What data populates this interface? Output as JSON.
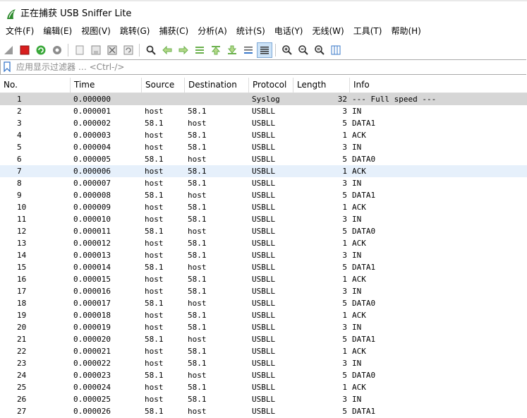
{
  "window": {
    "title": "正在捕获 USB Sniffer Lite"
  },
  "menu": [
    "文件(F)",
    "编辑(E)",
    "视图(V)",
    "跳转(G)",
    "捕获(C)",
    "分析(A)",
    "统计(S)",
    "电话(Y)",
    "无线(W)",
    "工具(T)",
    "帮助(H)"
  ],
  "toolbar_icons": [
    "shark-fin-start-icon",
    "stop-icon",
    "restart-icon",
    "gear-options-icon",
    "open-file-icon",
    "save-file-icon",
    "close-file-icon",
    "reload-icon",
    "find-icon",
    "back-arrow-icon",
    "forward-arrow-icon",
    "go-to-packet-icon",
    "first-packet-icon",
    "last-packet-icon",
    "autoscroll-icon",
    "colorize-icon",
    "zoom-in-icon",
    "zoom-out-icon",
    "normal-size-icon",
    "resize-columns-icon"
  ],
  "filter": {
    "placeholder": "应用显示过滤器 … <Ctrl-/>"
  },
  "columns": [
    "No.",
    "Time",
    "Source",
    "Destination",
    "Protocol",
    "Length",
    "Info"
  ],
  "rows": [
    {
      "no": "1",
      "time": "0.000000",
      "src": "",
      "dst": "",
      "proto": "Syslog",
      "len": "32",
      "info": "--- Full speed ---"
    },
    {
      "no": "2",
      "time": "0.000001",
      "src": "host",
      "dst": "58.1",
      "proto": "USBLL",
      "len": "3",
      "info": "IN"
    },
    {
      "no": "3",
      "time": "0.000002",
      "src": "58.1",
      "dst": "host",
      "proto": "USBLL",
      "len": "5",
      "info": "DATA1"
    },
    {
      "no": "4",
      "time": "0.000003",
      "src": "host",
      "dst": "58.1",
      "proto": "USBLL",
      "len": "1",
      "info": "ACK"
    },
    {
      "no": "5",
      "time": "0.000004",
      "src": "host",
      "dst": "58.1",
      "proto": "USBLL",
      "len": "3",
      "info": "IN"
    },
    {
      "no": "6",
      "time": "0.000005",
      "src": "58.1",
      "dst": "host",
      "proto": "USBLL",
      "len": "5",
      "info": "DATA0"
    },
    {
      "no": "7",
      "time": "0.000006",
      "src": "host",
      "dst": "58.1",
      "proto": "USBLL",
      "len": "1",
      "info": "ACK"
    },
    {
      "no": "8",
      "time": "0.000007",
      "src": "host",
      "dst": "58.1",
      "proto": "USBLL",
      "len": "3",
      "info": "IN"
    },
    {
      "no": "9",
      "time": "0.000008",
      "src": "58.1",
      "dst": "host",
      "proto": "USBLL",
      "len": "5",
      "info": "DATA1"
    },
    {
      "no": "10",
      "time": "0.000009",
      "src": "host",
      "dst": "58.1",
      "proto": "USBLL",
      "len": "1",
      "info": "ACK"
    },
    {
      "no": "11",
      "time": "0.000010",
      "src": "host",
      "dst": "58.1",
      "proto": "USBLL",
      "len": "3",
      "info": "IN"
    },
    {
      "no": "12",
      "time": "0.000011",
      "src": "58.1",
      "dst": "host",
      "proto": "USBLL",
      "len": "5",
      "info": "DATA0"
    },
    {
      "no": "13",
      "time": "0.000012",
      "src": "host",
      "dst": "58.1",
      "proto": "USBLL",
      "len": "1",
      "info": "ACK"
    },
    {
      "no": "14",
      "time": "0.000013",
      "src": "host",
      "dst": "58.1",
      "proto": "USBLL",
      "len": "3",
      "info": "IN"
    },
    {
      "no": "15",
      "time": "0.000014",
      "src": "58.1",
      "dst": "host",
      "proto": "USBLL",
      "len": "5",
      "info": "DATA1"
    },
    {
      "no": "16",
      "time": "0.000015",
      "src": "host",
      "dst": "58.1",
      "proto": "USBLL",
      "len": "1",
      "info": "ACK"
    },
    {
      "no": "17",
      "time": "0.000016",
      "src": "host",
      "dst": "58.1",
      "proto": "USBLL",
      "len": "3",
      "info": "IN"
    },
    {
      "no": "18",
      "time": "0.000017",
      "src": "58.1",
      "dst": "host",
      "proto": "USBLL",
      "len": "5",
      "info": "DATA0"
    },
    {
      "no": "19",
      "time": "0.000018",
      "src": "host",
      "dst": "58.1",
      "proto": "USBLL",
      "len": "1",
      "info": "ACK"
    },
    {
      "no": "20",
      "time": "0.000019",
      "src": "host",
      "dst": "58.1",
      "proto": "USBLL",
      "len": "3",
      "info": "IN"
    },
    {
      "no": "21",
      "time": "0.000020",
      "src": "58.1",
      "dst": "host",
      "proto": "USBLL",
      "len": "5",
      "info": "DATA1"
    },
    {
      "no": "22",
      "time": "0.000021",
      "src": "host",
      "dst": "58.1",
      "proto": "USBLL",
      "len": "1",
      "info": "ACK"
    },
    {
      "no": "23",
      "time": "0.000022",
      "src": "host",
      "dst": "58.1",
      "proto": "USBLL",
      "len": "3",
      "info": "IN"
    },
    {
      "no": "24",
      "time": "0.000023",
      "src": "58.1",
      "dst": "host",
      "proto": "USBLL",
      "len": "5",
      "info": "DATA0"
    },
    {
      "no": "25",
      "time": "0.000024",
      "src": "host",
      "dst": "58.1",
      "proto": "USBLL",
      "len": "1",
      "info": "ACK"
    },
    {
      "no": "26",
      "time": "0.000025",
      "src": "host",
      "dst": "58.1",
      "proto": "USBLL",
      "len": "3",
      "info": "IN"
    },
    {
      "no": "27",
      "time": "0.000026",
      "src": "58.1",
      "dst": "host",
      "proto": "USBLL",
      "len": "5",
      "info": "DATA1"
    }
  ],
  "colors": {
    "syslog_row_bg": "#d6d6d6",
    "selected_row_bg": "#e6f0fb",
    "stop_red": "#d81e1e",
    "accent_green": "#3aa83a",
    "arrow_green": "#6ab04c"
  }
}
